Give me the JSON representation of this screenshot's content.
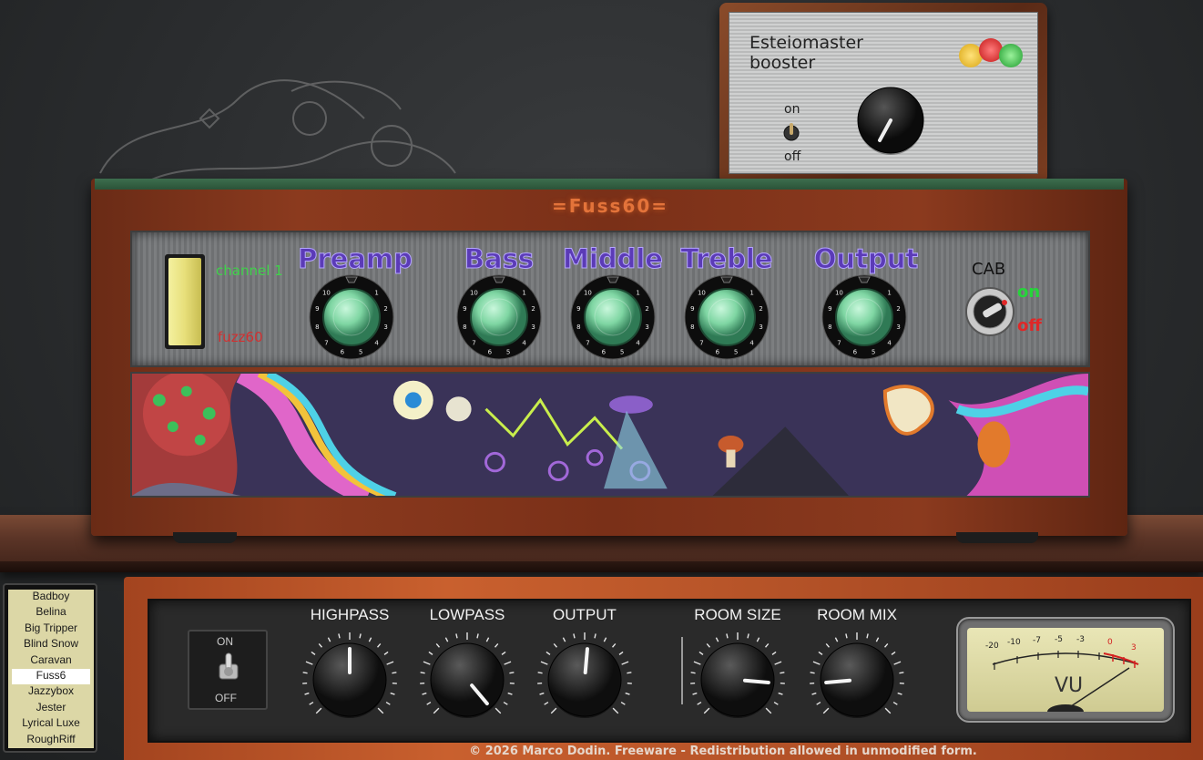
{
  "booster": {
    "title_line1": "Esteiomaster",
    "title_line2": "booster",
    "on_label": "on",
    "off_label": "off"
  },
  "amp": {
    "logo": "=Fuss60=",
    "channel1_label": "channel 1",
    "channel2_label": "fuzz60",
    "knob_labels": [
      "Preamp",
      "Bass",
      "Middle",
      "Treble",
      "Output"
    ],
    "knob_scale": [
      "1",
      "2",
      "3",
      "4",
      "5",
      "6",
      "7",
      "8",
      "9",
      "10"
    ],
    "cab_label": "CAB",
    "cab_on": "on",
    "cab_off": "off"
  },
  "presets": {
    "items": [
      "Badboy",
      "Belina",
      "Big Tripper",
      "Blind Snow",
      "Caravan",
      "Fuss6",
      "Jazzybox",
      "Jester",
      "Lyrical Luxe",
      "RoughRiff"
    ],
    "selected": "Fuss6"
  },
  "rack": {
    "on_label": "ON",
    "off_label": "OFF",
    "knob_labels": [
      "HIGHPASS",
      "LOWPASS",
      "OUTPUT",
      "ROOM SIZE",
      "ROOM MIX"
    ],
    "vu_label": "VU",
    "vu_scale": [
      "-20",
      "-10",
      "-7",
      "-5",
      "-3",
      "0",
      "3"
    ]
  },
  "footer": {
    "copyright": "© 2026 Marco Dodin. Freeware - Redistribution allowed in unmodified form."
  },
  "colors": {
    "amp_label_purple": "#5b3bb7",
    "channel_green": "#3fd34a",
    "channel_red": "#d23030",
    "knob_green": "#7fd6a3",
    "wood": "#8b3a1e",
    "rack_orange": "#c9602e"
  }
}
